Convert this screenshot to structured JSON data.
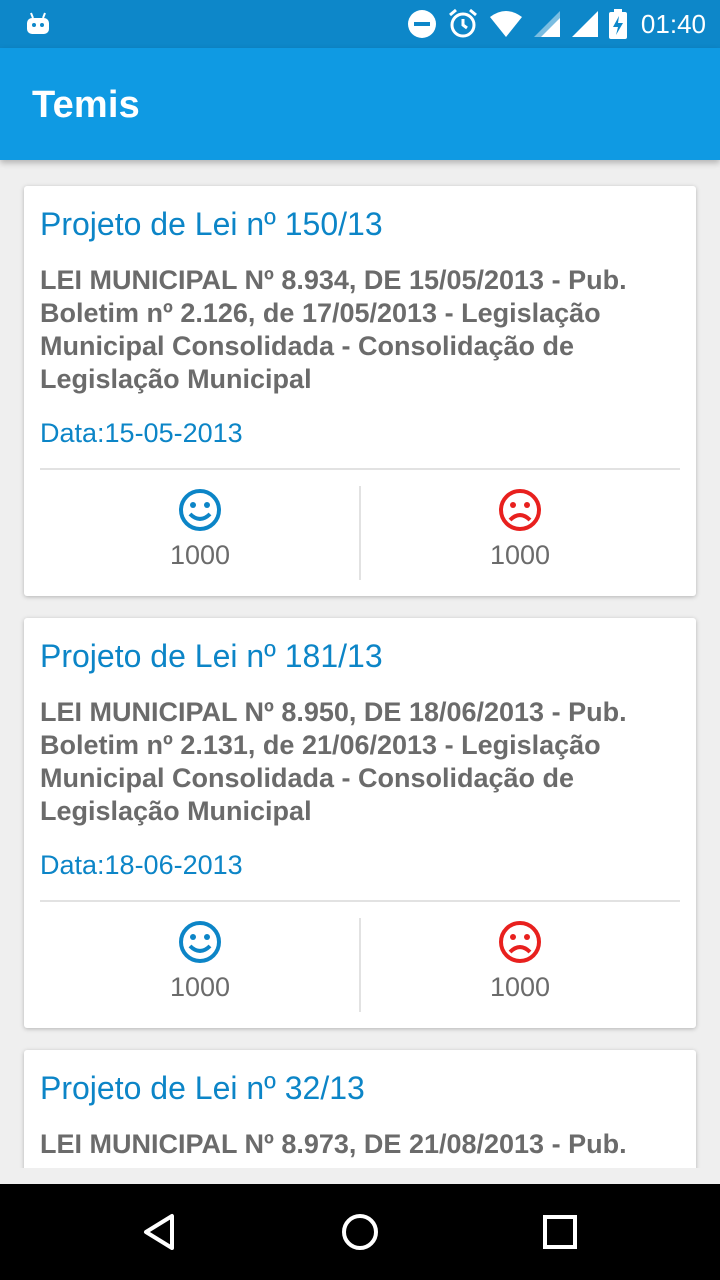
{
  "status_bar": {
    "time": "01:40",
    "icons": [
      "android-icon",
      "do-not-disturb-icon",
      "alarm-icon",
      "wifi-icon",
      "cell-signal-icon",
      "battery-charging-icon"
    ]
  },
  "app_bar": {
    "title": "Temis"
  },
  "colors": {
    "status_bar": "#0d87c9",
    "app_bar": "#0f9ae3",
    "accent": "#0c85c7",
    "dislike": "#e8201e",
    "text_grey": "#6b6b6b",
    "background": "#efefef"
  },
  "cards": [
    {
      "title": "Projeto de Lei nº 150/13",
      "lines": [
        "LEI MUNICIPAL Nº 8.934, DE 15/05/2013 - Pub.",
        "Boletim nº 2.126, de 17/05/2013 - Legislação",
        "Municipal Consolidada - Consolidação de",
        "Legislação Municipal"
      ],
      "date": "Data:15-05-2013",
      "likes": "1000",
      "dislikes": "1000"
    },
    {
      "title": "Projeto de Lei nº 181/13",
      "lines": [
        "LEI MUNICIPAL Nº 8.950, DE 18/06/2013 - Pub.",
        "Boletim nº 2.131, de 21/06/2013 - Legislação",
        "Municipal Consolidada - Consolidação de",
        "Legislação Municipal"
      ],
      "date": "Data:18-06-2013",
      "likes": "1000",
      "dislikes": "1000"
    },
    {
      "title": "Projeto de Lei nº 32/13",
      "lines": [
        "LEI MUNICIPAL Nº 8.973, DE 21/08/2013 - Pub."
      ]
    }
  ],
  "nav_bar": {
    "buttons": [
      "back-icon",
      "home-icon",
      "recents-icon"
    ]
  }
}
